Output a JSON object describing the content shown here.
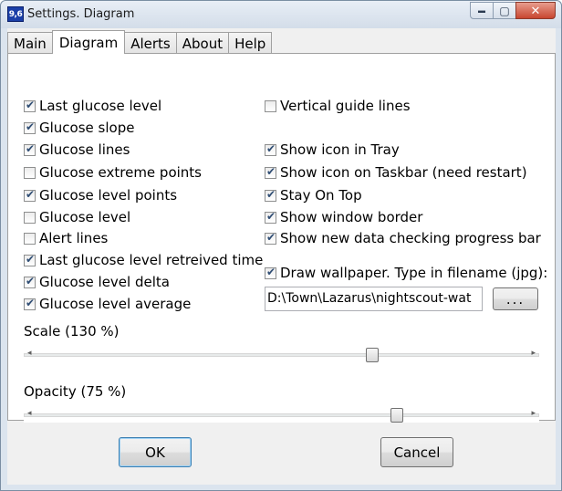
{
  "window": {
    "icon_text": "9,6",
    "title": "Settings. Diagram",
    "minimize_symbol": "▬",
    "maximize_symbol": "▢",
    "close_symbol": "✕"
  },
  "tabs": [
    {
      "label": "Main",
      "active": false
    },
    {
      "label": "Diagram",
      "active": true
    },
    {
      "label": "Alerts",
      "active": false
    },
    {
      "label": "About",
      "active": false
    },
    {
      "label": "Help",
      "active": false
    }
  ],
  "left_checkboxes": [
    {
      "label": "Last glucose level",
      "checked": true
    },
    {
      "label": "Glucose slope",
      "checked": true
    },
    {
      "label": "Glucose lines",
      "checked": true
    },
    {
      "label": "Glucose extreme points",
      "checked": false
    },
    {
      "label": "Glucose level points",
      "checked": true
    },
    {
      "label": "Glucose level",
      "checked": false
    },
    {
      "label": "Alert lines",
      "checked": false
    },
    {
      "label": "Last glucose level retreived time",
      "checked": true
    },
    {
      "label": "Glucose level delta",
      "checked": true
    },
    {
      "label": "Glucose level average",
      "checked": true
    }
  ],
  "right_checkboxes": [
    {
      "label": "Vertical guide lines",
      "checked": false
    },
    {
      "label": "Show icon in Tray",
      "checked": true
    },
    {
      "label": "Show icon on Taskbar (need restart)",
      "checked": true
    },
    {
      "label": "Stay On Top",
      "checked": true
    },
    {
      "label": "Show window border",
      "checked": true
    },
    {
      "label": "Show new data checking progress bar",
      "checked": true
    },
    {
      "label": "Draw wallpaper. Type in filename (jpg):",
      "checked": true
    }
  ],
  "wallpaper": {
    "filename_value": "D:\\Town\\Lazarus\\nightscout-wat",
    "browse_label": "..."
  },
  "scale": {
    "label": "Scale (130 %)",
    "value_percent": 130,
    "slider_fraction": 0.68
  },
  "opacity": {
    "label": "Opacity (75 %)",
    "value_percent": 75,
    "slider_fraction": 0.73
  },
  "trackbar_arrows": {
    "left": "◂",
    "right": "▸"
  },
  "buttons": {
    "ok": "OK",
    "cancel": "Cancel"
  },
  "colors": {
    "window_frame": "#dbe4ee",
    "close_button": "#c84630",
    "check_mark": "#2f4d74",
    "default_button_border": "#3c7fb1"
  }
}
